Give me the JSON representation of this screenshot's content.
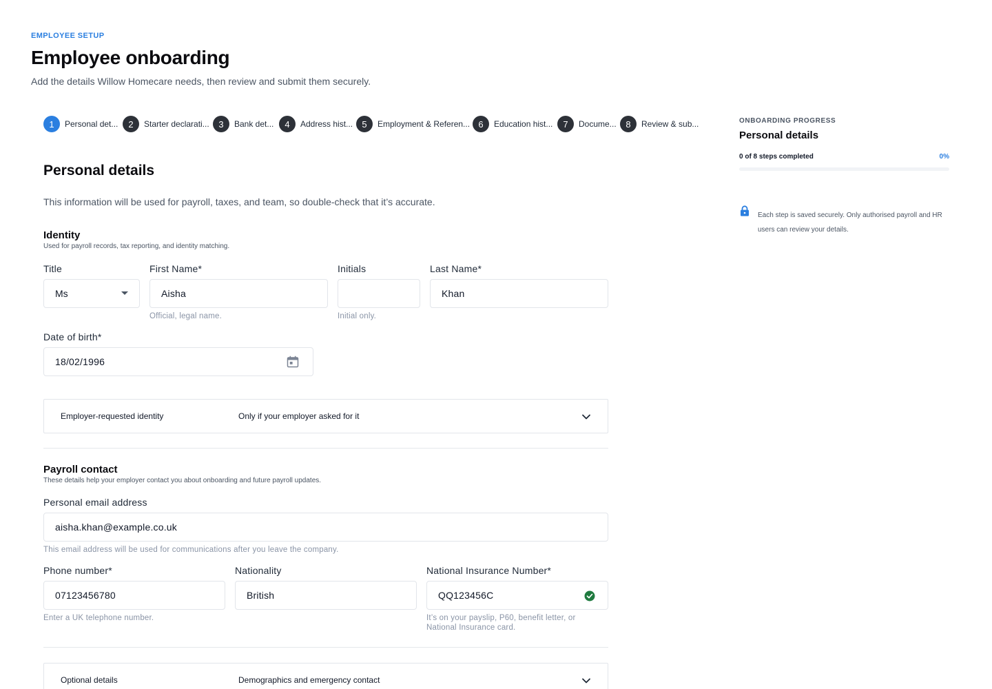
{
  "header": {
    "eyebrow": "EMPLOYEE SETUP",
    "title": "Employee onboarding",
    "subtitle": "Add the details Willow Homecare needs, then review and submit them securely."
  },
  "stepper": {
    "steps": [
      {
        "number": "1",
        "label": "Personal det..."
      },
      {
        "number": "2",
        "label": "Starter declarati..."
      },
      {
        "number": "3",
        "label": "Bank det..."
      },
      {
        "number": "4",
        "label": "Address hist..."
      },
      {
        "number": "5",
        "label": "Employment & Referen..."
      },
      {
        "number": "6",
        "label": "Education hist..."
      },
      {
        "number": "7",
        "label": "Docume..."
      },
      {
        "number": "8",
        "label": "Review & sub..."
      }
    ],
    "active_index": 0
  },
  "section": {
    "title": "Personal details",
    "description": "This information will be used for payroll, taxes, and team, so double-check that it’s accurate."
  },
  "identity": {
    "title": "Identity",
    "subtitle": "Used for payroll records, tax reporting, and identity matching.",
    "title_field": {
      "label": "Title",
      "value": "Ms"
    },
    "first_name": {
      "label": "First Name*",
      "value": "Aisha",
      "hint": "Official, legal name."
    },
    "initials": {
      "label": "Initials",
      "value": "",
      "hint": "Initial only."
    },
    "last_name": {
      "label": "Last Name*",
      "value": "Khan"
    },
    "dob": {
      "label": "Date of birth*",
      "value": "18/02/1996"
    },
    "employer_identity": {
      "title": "Employer-requested identity",
      "description": "Only if your employer asked for it"
    }
  },
  "payroll_contact": {
    "title": "Payroll contact",
    "subtitle": "These details help your employer contact you about onboarding and future payroll updates.",
    "email": {
      "label": "Personal email address",
      "value": "aisha.khan@example.co.uk",
      "hint": "This email address will be used for communications after you leave the company."
    },
    "phone": {
      "label": "Phone number*",
      "value": "07123456780",
      "hint": "Enter a UK telephone number."
    },
    "nationality": {
      "label": "Nationality",
      "value": "British"
    },
    "ni_number": {
      "label": "National Insurance Number*",
      "value": "QQ123456C",
      "hint_line1": "It’s on your payslip, P60, benefit letter, or",
      "hint_line2": "National Insurance card."
    },
    "optional": {
      "title": "Optional details",
      "description": "Demographics and emergency contact"
    }
  },
  "progress": {
    "eyebrow": "ONBOARDING PROGRESS",
    "title": "Personal details",
    "count_text": "0 of 8 steps completed",
    "percent_text": "0%",
    "percent": 0,
    "note": "Each step is saved securely. Only authorised payroll and HR users can review your details."
  },
  "colors": {
    "accent": "#2b7fe0",
    "step_inactive": "#2d3138",
    "success": "#1f7a3f"
  },
  "icons": {
    "title_dropdown": "caret-down-icon",
    "dob_picker": "calendar-icon",
    "ni_valid": "check-circle-icon",
    "accordion": "chevron-down-icon",
    "security": "lock-icon"
  }
}
